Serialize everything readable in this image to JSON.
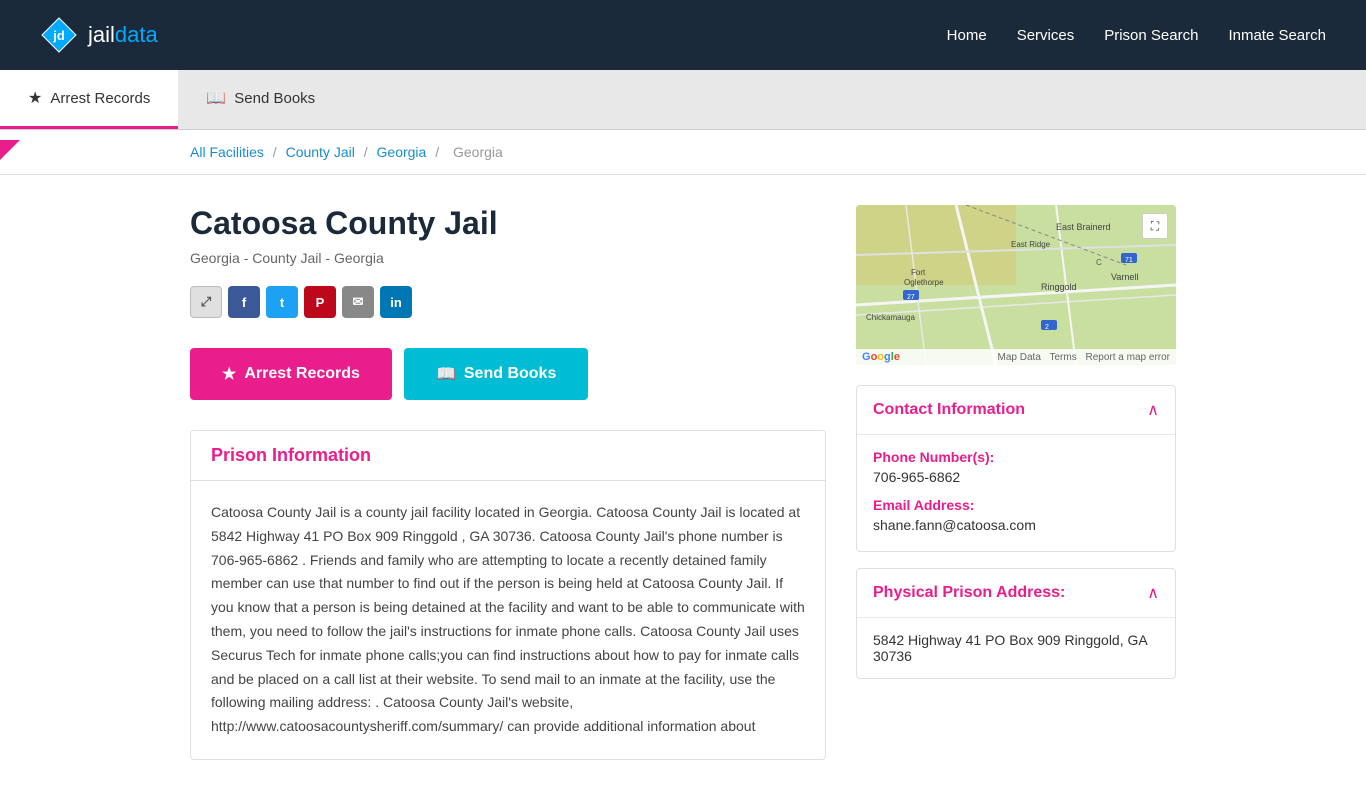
{
  "header": {
    "logo_text_jail": "jail",
    "logo_text_data": "data",
    "nav": {
      "home": "Home",
      "services": "Services",
      "prison_search": "Prison Search",
      "inmate_search": "Inmate Search"
    }
  },
  "tabs": [
    {
      "id": "arrest-records",
      "label": "Arrest Records",
      "icon": "★",
      "active": true
    },
    {
      "id": "send-books",
      "label": "Send Books",
      "icon": "📖",
      "active": false
    }
  ],
  "breadcrumb": {
    "all_facilities": "All Facilities",
    "county_jail": "County Jail",
    "georgia": "Georgia",
    "current": "Georgia"
  },
  "facility": {
    "name": "Catoosa County Jail",
    "subtitle": "Georgia - County Jail - Georgia"
  },
  "social": {
    "share": "⤢",
    "facebook": "f",
    "twitter": "t",
    "pinterest": "P",
    "email": "✉",
    "linkedin": "in"
  },
  "action_buttons": {
    "arrest_records": "Arrest Records",
    "send_books": "Send Books"
  },
  "prison_info": {
    "title": "Prison Information",
    "body": "Catoosa County Jail is a county jail facility located in Georgia. Catoosa County Jail is located at 5842 Highway 41 PO Box 909 Ringgold , GA 30736. Catoosa County Jail's phone number is 706-965-6862 . Friends and family who are attempting to locate a recently detained family member can use that number to find out if the person is being held at Catoosa County Jail. If you know that a person is being detained at the facility and want to be able to communicate with them, you need to follow the jail's instructions for inmate phone calls. Catoosa County Jail uses Securus Tech for inmate phone calls;you can find instructions about how to pay for inmate calls and be placed on a call list at their website. To send mail to an inmate at the facility, use the following mailing address: . Catoosa County Jail's website, http://www.catoosacountysheriff.com/summary/ can provide additional information about"
  },
  "map": {
    "expand_icon": "⛶",
    "map_data_label": "Map Data",
    "terms_label": "Terms",
    "report_label": "Report a map error"
  },
  "contact_info": {
    "section_title": "Contact Information",
    "phone_label": "Phone Number(s):",
    "phone_value": "706-965-6862",
    "email_label": "Email Address:",
    "email_value": "shane.fann@catoosa.com",
    "chevron": "∧"
  },
  "address_info": {
    "section_title": "Physical Prison Address:",
    "address_value": "5842 Highway 41 PO Box 909 Ringgold, GA 30736",
    "chevron": "∧"
  }
}
